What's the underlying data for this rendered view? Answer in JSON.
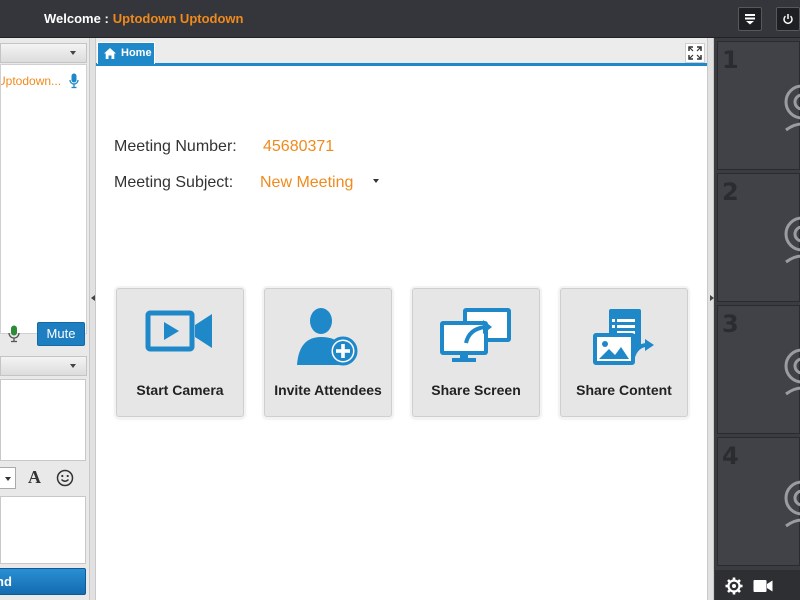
{
  "header": {
    "welcome_label": "Welcome :",
    "user_name": "Uptodown Uptodown"
  },
  "left_panel": {
    "participant_name": "Uptodown...",
    "mute_label": "Mute",
    "font_button": "A",
    "send_label": "nd"
  },
  "main": {
    "tab_home": "Home",
    "meeting_number_label": "Meeting Number:",
    "meeting_number": "45680371",
    "meeting_subject_label": "Meeting Subject:",
    "meeting_subject": "New Meeting",
    "actions": [
      {
        "label": "Start Camera",
        "icon": "video-camera-icon"
      },
      {
        "label": "Invite Attendees",
        "icon": "invite-user-icon"
      },
      {
        "label": "Share Screen",
        "icon": "share-screen-icon"
      },
      {
        "label": "Share Content",
        "icon": "share-content-icon"
      }
    ]
  },
  "video_strip": {
    "tiles": [
      "1",
      "2",
      "3",
      "4"
    ]
  },
  "colors": {
    "accent_blue": "#1e88c9",
    "accent_orange": "#f08a1c",
    "dark_bg": "#34363b"
  }
}
